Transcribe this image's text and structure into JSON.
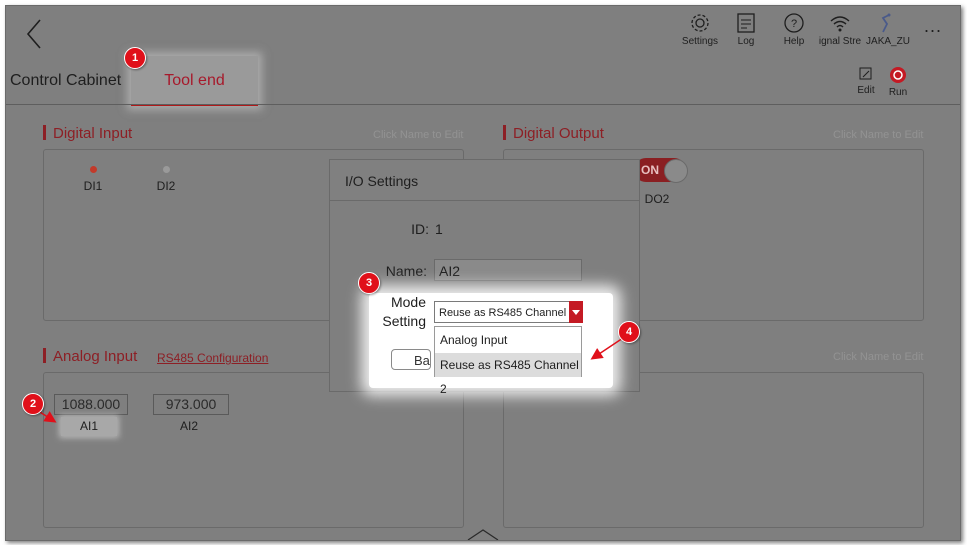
{
  "topbar": {
    "items": [
      {
        "label": "Settings",
        "icon": "gear-icon"
      },
      {
        "label": "Log",
        "icon": "log-icon"
      },
      {
        "label": "Help",
        "icon": "help-icon"
      },
      {
        "label": "ignal Stre",
        "icon": "wifi-icon"
      },
      {
        "label": "JAKA_ZU",
        "icon": "robot-icon"
      }
    ],
    "more": "..."
  },
  "tabs": {
    "control_cabinet": "Control Cabinet",
    "tool_end": "Tool end"
  },
  "actions": {
    "edit": "Edit",
    "run": "Run"
  },
  "digital_input": {
    "title": "Digital Input",
    "hint": "Click Name to Edit",
    "items": [
      "DI1",
      "DI2"
    ]
  },
  "digital_output": {
    "title": "Digital Output",
    "hint": "Click Name to Edit",
    "toggle": "ON",
    "items": [
      "DO2"
    ]
  },
  "analog_input": {
    "title": "Analog Input",
    "link": "RS485 Configuration",
    "items": [
      {
        "value": "1088.000",
        "label": "AI1"
      },
      {
        "value": "973.000",
        "label": "AI2"
      }
    ]
  },
  "analog_output": {
    "hint": "Click Name to Edit"
  },
  "dialog": {
    "title": "I/O Settings",
    "id_label": "ID:",
    "id_value": "1",
    "name_label": "Name:",
    "name_value": "AI2",
    "mode_label_1": "Mode",
    "mode_label_2": "Setting",
    "mode_value": "Reuse as RS485 Channel 2",
    "options": [
      "Analog Input",
      "Reuse as RS485 Channel 2"
    ],
    "back_partial": "Bac"
  },
  "badges": [
    "1",
    "2",
    "3",
    "4"
  ],
  "colors": {
    "accent": "#a7192b",
    "badge": "#e0101a"
  }
}
